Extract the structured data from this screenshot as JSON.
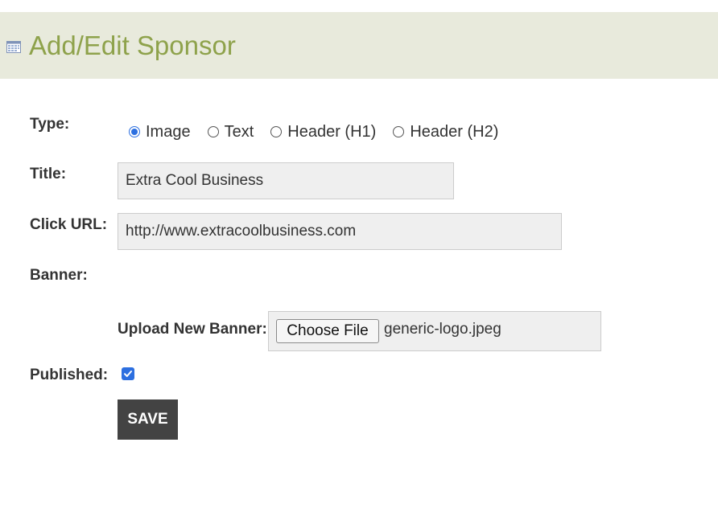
{
  "header": {
    "title": "Add/Edit Sponsor",
    "icon": "calendar-icon",
    "background_color": "#e8eadc",
    "title_color": "#8ea24b"
  },
  "form": {
    "type": {
      "label": "Type:",
      "options": [
        "Image",
        "Text",
        "Header (H1)",
        "Header (H2)"
      ],
      "selected": "Image"
    },
    "title": {
      "label": "Title:",
      "value": "Extra Cool Business"
    },
    "click_url": {
      "label": "Click URL:",
      "value": "http://www.extracoolbusiness.com"
    },
    "banner": {
      "label": "Banner:",
      "upload_label": "Upload New Banner:",
      "choose_button": "Choose File",
      "file_name": "generic-logo.jpeg"
    },
    "published": {
      "label": "Published:",
      "checked": true
    },
    "save_button": "SAVE"
  },
  "colors": {
    "accent": "#2c6fe0",
    "save_button_bg": "#434343",
    "input_bg": "#efefef"
  }
}
